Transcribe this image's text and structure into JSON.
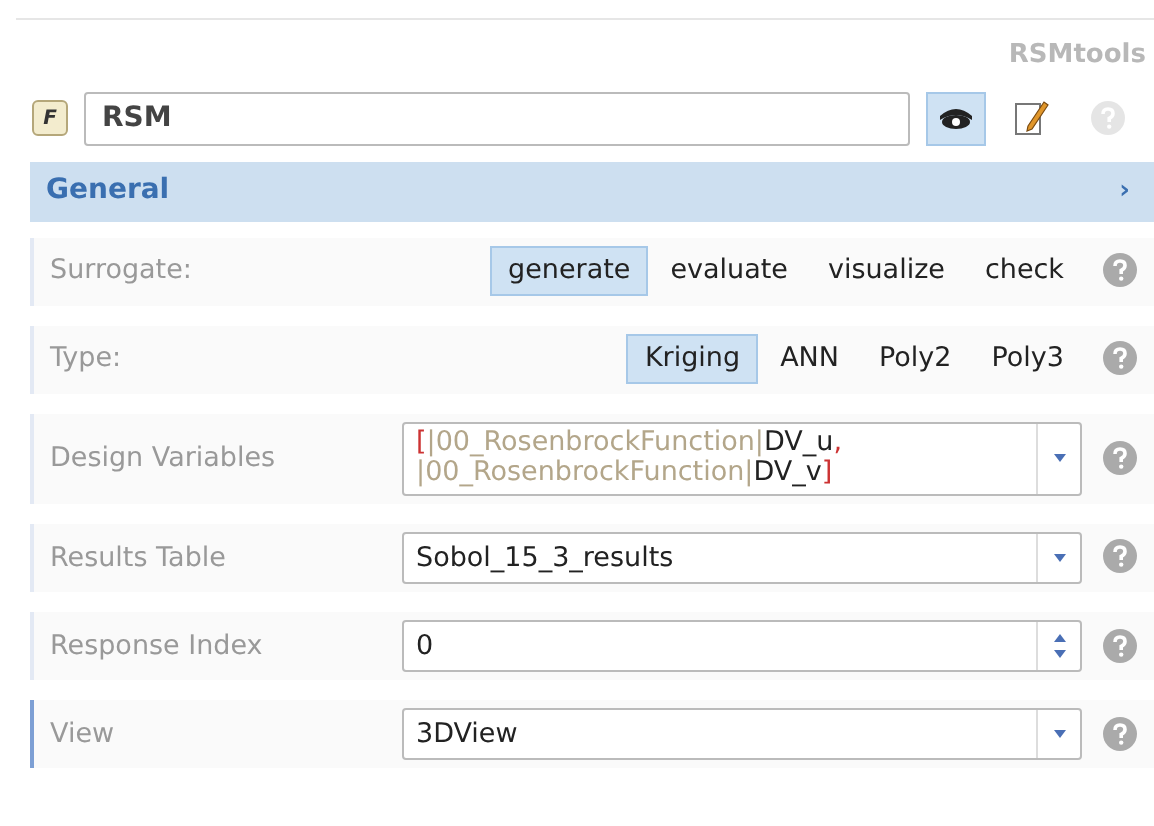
{
  "toolbox": {
    "title": "RSMtools",
    "badge": "F",
    "name_value": "RSM",
    "actions": [
      {
        "kind": "view",
        "selected": true,
        "disabled": false
      },
      {
        "kind": "edit",
        "selected": false,
        "disabled": false
      },
      {
        "kind": "help",
        "selected": false,
        "disabled": true
      }
    ]
  },
  "section": {
    "title": "General",
    "expander": "›"
  },
  "rows": [
    {
      "kind": "options",
      "label": "Surrogate:",
      "focused": false,
      "options": [
        {
          "label": "generate",
          "selected": true
        },
        {
          "label": "evaluate",
          "selected": false
        },
        {
          "label": "visualize",
          "selected": false
        },
        {
          "label": "check",
          "selected": false
        }
      ]
    },
    {
      "kind": "options",
      "label": "Type:",
      "focused": false,
      "options": [
        {
          "label": "Kriging",
          "selected": true
        },
        {
          "label": "ANN",
          "selected": false
        },
        {
          "label": "Poly2",
          "selected": false
        },
        {
          "label": "Poly3",
          "selected": false
        }
      ]
    },
    {
      "kind": "multiselect",
      "label": "Design Variables",
      "focused": false,
      "tokens": [
        {
          "text": "[",
          "kind": "bracket"
        },
        {
          "text": "|00_RosenbrockFunction|",
          "kind": "path"
        },
        {
          "text": "DV_u",
          "kind": "name"
        },
        {
          "text": ", ",
          "kind": "bracket"
        },
        {
          "text": "|",
          "kind": "path"
        },
        {
          "text": "00_RosenbrockFunction|",
          "kind": "path"
        },
        {
          "text": "DV_v",
          "kind": "name"
        },
        {
          "text": "]",
          "kind": "bracket"
        }
      ]
    },
    {
      "kind": "select",
      "label": "Results Table",
      "focused": false,
      "value": "Sobol_15_3_results"
    },
    {
      "kind": "spin",
      "label": "Response Index",
      "focused": false,
      "value": "0"
    },
    {
      "kind": "select",
      "label": "View",
      "focused": true,
      "value": "3DView"
    }
  ]
}
